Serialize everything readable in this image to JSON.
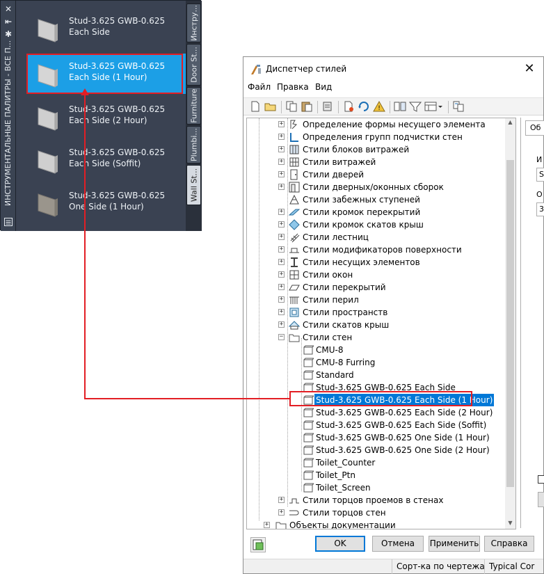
{
  "palette": {
    "side_buttons": {
      "close": "✕",
      "autohide": "⇤",
      "properties": "✱"
    },
    "vertical_title": "ИНСТРУМЕНТАЛЬНЫЕ ПАЛИТРЫ - ВСЕ П...",
    "tools": [
      {
        "label": "Stud-3.625 GWB-0.625 Each Side"
      },
      {
        "label": "Stud-3.625 GWB-0.625 Each Side (1 Hour)"
      },
      {
        "label": "Stud-3.625 GWB-0.625 Each Side (2 Hour)"
      },
      {
        "label": "Stud-3.625 GWB-0.625 Each Side (Soffit)"
      },
      {
        "label": "Stud-3.625 GWB-0.625 One Side (1 Hour)"
      }
    ],
    "tabs": [
      {
        "label": "Инстру..."
      },
      {
        "label": "Door St..."
      },
      {
        "label": "Furniture"
      },
      {
        "label": "Plumbi..."
      },
      {
        "label": "Wall St..."
      }
    ],
    "colors": {
      "selected": "#1c9fe6",
      "highlight": "#e31e24"
    }
  },
  "dialog": {
    "title": "Диспетчер стилей",
    "menu": [
      {
        "label": "Файл"
      },
      {
        "label": "Правка"
      },
      {
        "label": "Вид"
      }
    ],
    "tree": [
      {
        "label": "Определение формы несущего элемента"
      },
      {
        "label": "Определения групп подчистки стен"
      },
      {
        "label": "Стили блоков витражей"
      },
      {
        "label": "Стили витражей"
      },
      {
        "label": "Стили дверей"
      },
      {
        "label": "Стили дверных/оконных сборок"
      },
      {
        "label": "Стили забежных ступеней"
      },
      {
        "label": "Стили кромок перекрытий"
      },
      {
        "label": "Стили кромок скатов крыш"
      },
      {
        "label": "Стили лестниц"
      },
      {
        "label": "Стили модификаторов поверхности"
      },
      {
        "label": "Стили несущих элементов"
      },
      {
        "label": "Стили окон"
      },
      {
        "label": "Стили перекрытий"
      },
      {
        "label": "Стили перил"
      },
      {
        "label": "Стили пространств"
      },
      {
        "label": "Стили скатов крыш"
      },
      {
        "label": "Стили стен"
      },
      {
        "label": "CMU-8"
      },
      {
        "label": "CMU-8 Furring"
      },
      {
        "label": "Standard"
      },
      {
        "label": "Stud-3.625 GWB-0.625 Each Side"
      },
      {
        "label": "Stud-3.625 GWB-0.625 Each Side (1 Hour)"
      },
      {
        "label": "Stud-3.625 GWB-0.625 Each Side (2 Hour)"
      },
      {
        "label": "Stud-3.625 GWB-0.625 Each Side (Soffit)"
      },
      {
        "label": "Stud-3.625 GWB-0.625 One Side (1 Hour)"
      },
      {
        "label": "Stud-3.625 GWB-0.625 One Side (2 Hour)"
      },
      {
        "label": "Toilet_Counter"
      },
      {
        "label": "Toilet_Ptn"
      },
      {
        "label": "Toilet_Screen"
      },
      {
        "label": "Стили торцов проемов в стенах"
      },
      {
        "label": "Стили торцов стен"
      },
      {
        "label": "Объекты документации"
      }
    ],
    "right_pane": {
      "tab": "Об",
      "label1": "И",
      "value1": "S",
      "label2": "О",
      "value2": "3"
    },
    "buttons": {
      "ok": "OK",
      "cancel": "Отмена",
      "apply": "Применить",
      "help": "Справка"
    },
    "status": {
      "sort": "Сорт-ка по чертежам",
      "drawing": "Typical Cor"
    },
    "colors": {
      "selection": "#0078d7"
    }
  }
}
